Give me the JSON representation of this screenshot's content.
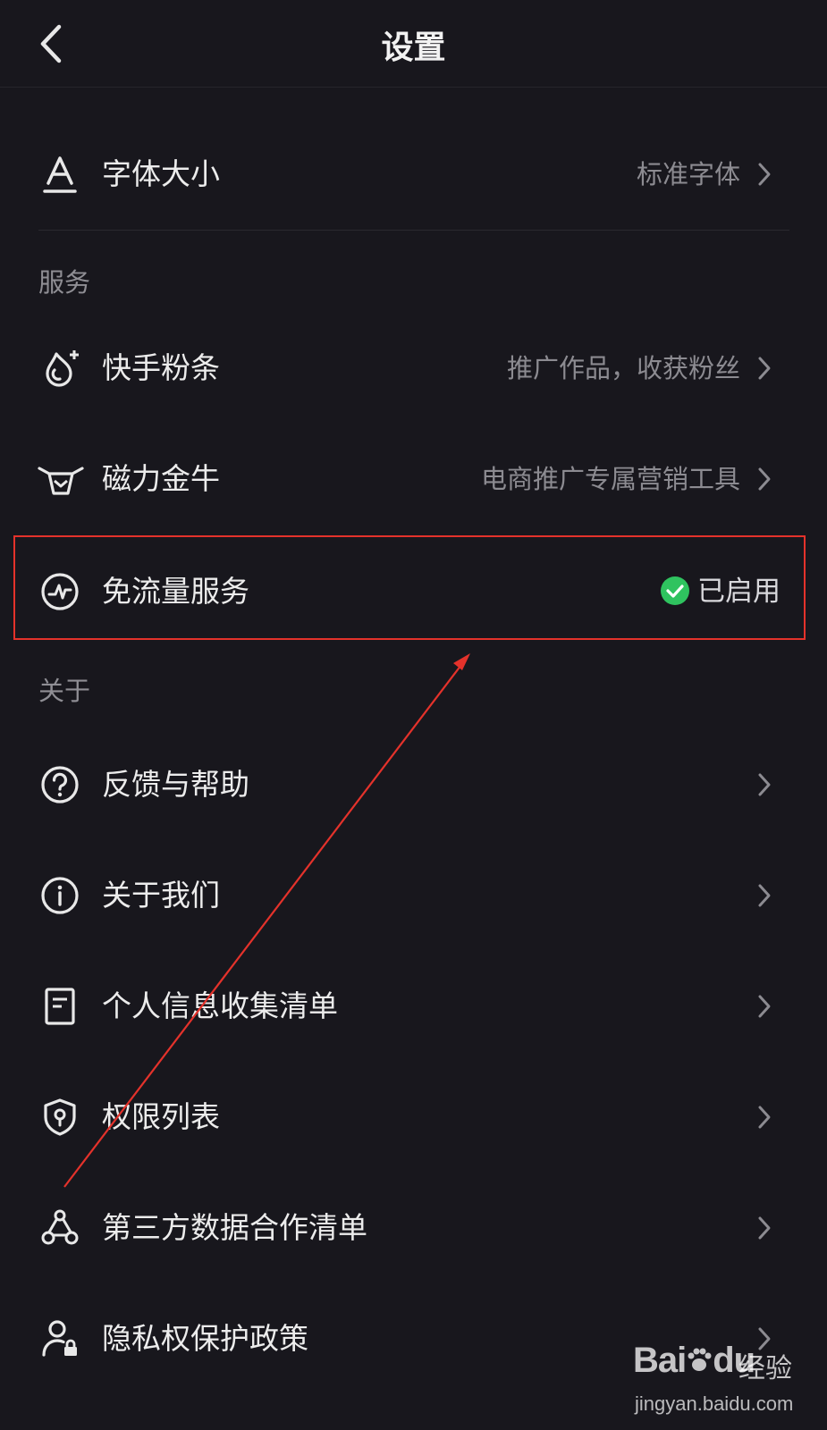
{
  "header": {
    "title": "设置"
  },
  "font_size_row": {
    "label": "字体大小",
    "value": "标准字体"
  },
  "services": {
    "section_title": "服务",
    "items": [
      {
        "label": "快手粉条",
        "value": "推广作品，收获粉丝",
        "icon": "flame-plus-icon"
      },
      {
        "label": "磁力金牛",
        "value": "电商推广专属营销工具",
        "icon": "bull-icon"
      },
      {
        "label": "免流量服务",
        "value": "已启用",
        "icon": "pulse-circle-icon",
        "highlighted": true,
        "status_color": "#2fc35f"
      }
    ]
  },
  "about": {
    "section_title": "关于",
    "items": [
      {
        "label": "反馈与帮助",
        "icon": "question-circle-icon"
      },
      {
        "label": "关于我们",
        "icon": "info-circle-icon"
      },
      {
        "label": "个人信息收集清单",
        "icon": "document-icon"
      },
      {
        "label": "权限列表",
        "icon": "shield-icon"
      },
      {
        "label": "第三方数据合作清单",
        "icon": "network-icon"
      },
      {
        "label": "隐私权保护政策",
        "icon": "user-lock-icon"
      }
    ]
  },
  "watermark": {
    "brand": "Bai",
    "brand2": "du",
    "suffix": "经验",
    "url": "jingyan.baidu.com"
  },
  "colors": {
    "background": "#18171d",
    "highlight": "#e4322b",
    "arrow": "#e4322b",
    "enabled": "#2fc35f"
  }
}
